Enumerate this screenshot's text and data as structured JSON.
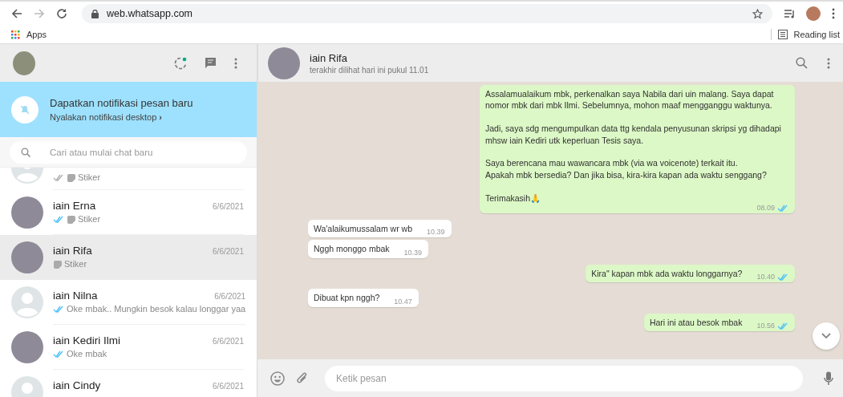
{
  "browser": {
    "url": "web.whatsapp.com",
    "bookmarks": [
      "Apps"
    ],
    "reading_list": "Reading list"
  },
  "notification": {
    "title": "Dapatkan notifikasi pesan baru",
    "action": "Nyalakan notifikasi desktop",
    "chevron": "›"
  },
  "search": {
    "placeholder": "Cari atau mulai chat baru"
  },
  "chats": [
    {
      "ticks": true,
      "read": false,
      "sticker": true,
      "preview": "Stiker",
      "selected": false,
      "has_photo": false
    },
    {
      "name": "iain Erna",
      "time": "6/6/2021",
      "ticks": true,
      "read": true,
      "sticker": true,
      "preview": "Stiker",
      "selected": false,
      "has_photo": true
    },
    {
      "name": "iain Rifa",
      "time": "6/6/2021",
      "ticks": false,
      "sticker": true,
      "preview": "Stiker",
      "selected": true,
      "has_photo": true
    },
    {
      "name": "iain Nilna",
      "time": "6/6/2021",
      "ticks": true,
      "read": true,
      "sticker": false,
      "preview": "Oke mbak.. Mungkin besok kalau longgar yaa",
      "selected": false,
      "has_photo": false
    },
    {
      "name": "iain Kediri Ilmi",
      "time": "6/6/2021",
      "ticks": true,
      "read": true,
      "sticker": false,
      "preview": "Oke mbak",
      "selected": false,
      "has_photo": true
    },
    {
      "name": "iain Cindy",
      "time": "6/6/2021",
      "ticks": false,
      "sticker": false,
      "selected": false,
      "has_photo": false
    }
  ],
  "conversation": {
    "name": "iain Rifa",
    "status": "terakhir dilihat hari ini pukul 11.01"
  },
  "messages": [
    {
      "outgoing": true,
      "text": "Assalamualaikum mbk, perkenalkan saya Nabila dari uin malang. Saya dapat nomor mbk dari mbk Ilmi. Sebelumnya, mohon maaf mengganggu waktunya.\n\nJadi, saya sdg mengumpulkan data ttg kendala penyusunan skripsi yg dihadapi mhsw iain Kediri utk keperluan Tesis saya.\n\nSaya berencana mau wawancara mbk (via wa voicenote) terkait itu.\nApakah mbk bersedia? Dan jika bisa, kira-kira kapan ada waktu senggang?\n\nTerimakasih🙏",
      "time": "08.09",
      "read": true
    },
    {
      "outgoing": false,
      "text": "Wa'alaikumussalam wr wb",
      "time": "10.39"
    },
    {
      "outgoing": false,
      "text": "Nggh monggo mbak",
      "time": "10.39"
    },
    {
      "outgoing": true,
      "text": "Kira\" kapan mbk ada waktu longgarnya?",
      "time": "10.40",
      "read": true
    },
    {
      "outgoing": false,
      "text": "Dibuat kpn nggh?",
      "time": "10.47"
    },
    {
      "outgoing": true,
      "text": "Hari ini atau besok mbak",
      "time": "10.56",
      "read": true
    }
  ],
  "composer": {
    "placeholder": "Ketik pesan"
  }
}
